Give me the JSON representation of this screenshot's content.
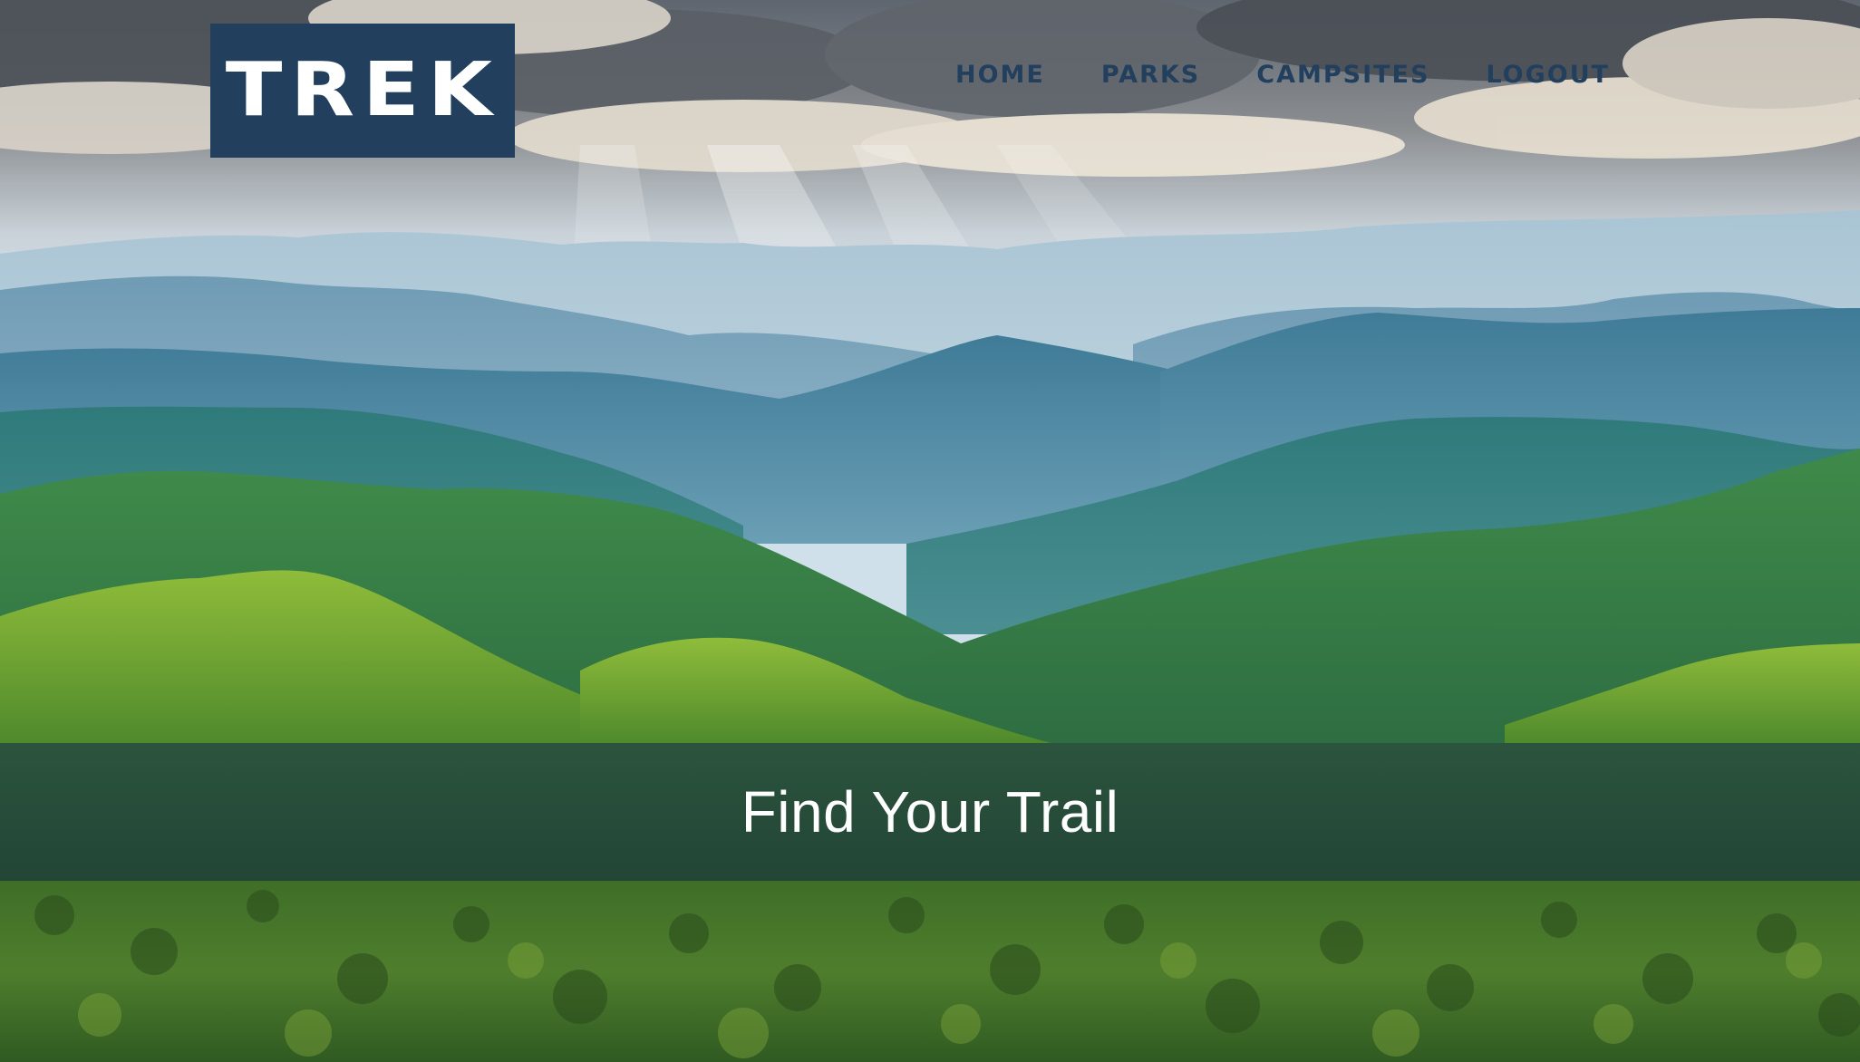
{
  "brand": {
    "logo_text": "TREK",
    "logo_bg": "#223f5e",
    "logo_fg": "#ffffff"
  },
  "nav": {
    "items": [
      {
        "label": "HOME"
      },
      {
        "label": "PARKS"
      },
      {
        "label": "CAMPSITES"
      },
      {
        "label": "LOGOUT"
      }
    ],
    "color": "#223f5e"
  },
  "hero": {
    "image": "mountain-landscape-with-sunrays",
    "banner_title": "Find Your Trail"
  }
}
